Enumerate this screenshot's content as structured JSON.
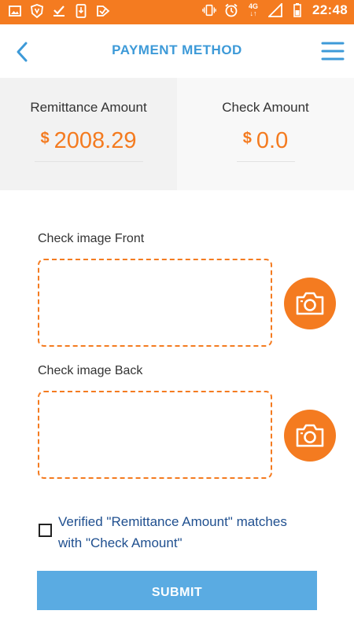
{
  "status_bar": {
    "time": "22:48",
    "network": "4G",
    "left_icons": [
      "image-icon",
      "browser-shield-icon",
      "download-icon",
      "phone-download-icon",
      "tasks-check-icon"
    ],
    "right_icons": [
      "vibrate-icon",
      "alarm-icon",
      "network-4g-icon",
      "signal-icon",
      "battery-icon"
    ]
  },
  "header": {
    "title": "PAYMENT METHOD",
    "back_icon": "chevron-left-icon",
    "menu_icon": "hamburger-menu-icon"
  },
  "amounts": {
    "remittance": {
      "label": "Remittance Amount",
      "currency": "$",
      "value": "2008.29"
    },
    "check": {
      "label": "Check Amount",
      "currency": "$",
      "value": "0.0"
    }
  },
  "check_images": {
    "front_label": "Check image Front",
    "back_label": "Check image Back",
    "camera_icon": "camera-icon"
  },
  "verify": {
    "checked": false,
    "text": "Verified \"Remittance Amount\" matches with \"Check Amount\""
  },
  "submit": {
    "label": "SUBMIT"
  },
  "colors": {
    "accent": "#f47b20",
    "title_blue": "#3d9ad8",
    "submit_blue": "#5aabe2",
    "verify_text": "#1f4f8f"
  }
}
